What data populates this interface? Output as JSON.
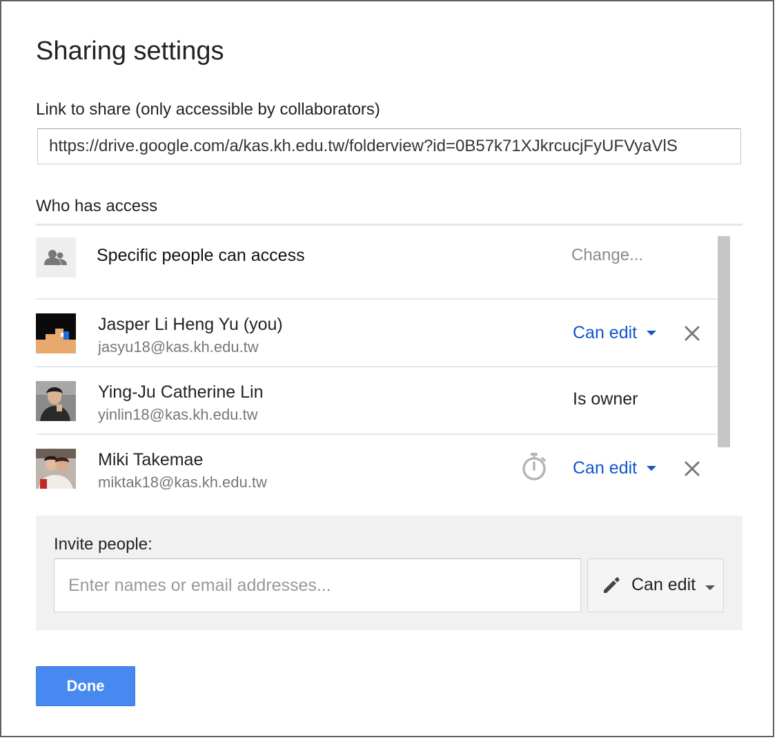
{
  "dialog": {
    "title": "Sharing settings",
    "link_label": "Link to share (only accessible by collaborators)",
    "link_value": "https://drive.google.com/a/kas.kh.edu.tw/folderview?id=0B57k71XJkrcucjFyUFVyaVlS",
    "access_label": "Who has access"
  },
  "access": {
    "visibility_icon": "people-icon",
    "visibility_text": "Specific people can access",
    "change_label": "Change...",
    "people": [
      {
        "name": "Jasper Li Heng Yu (you)",
        "email": "jasyu18@kas.kh.edu.tw",
        "permission": "Can edit",
        "removable": true
      },
      {
        "name": "Ying-Ju Catherine Lin",
        "email": "yinlin18@kas.kh.edu.tw",
        "permission": "Is owner",
        "removable": false
      },
      {
        "name": "Miki Takemae",
        "email": "miktak18@kas.kh.edu.tw",
        "permission": "Can edit",
        "removable": true,
        "icon": "timer-icon"
      }
    ]
  },
  "invite": {
    "label": "Invite people:",
    "placeholder": "Enter names or email addresses...",
    "permission": "Can edit",
    "permission_icon": "pencil-icon"
  },
  "actions": {
    "done_label": "Done"
  },
  "colors": {
    "link_blue": "#1155cc",
    "primary_button": "#4889f1",
    "panel_bg": "#f1f1f1"
  }
}
